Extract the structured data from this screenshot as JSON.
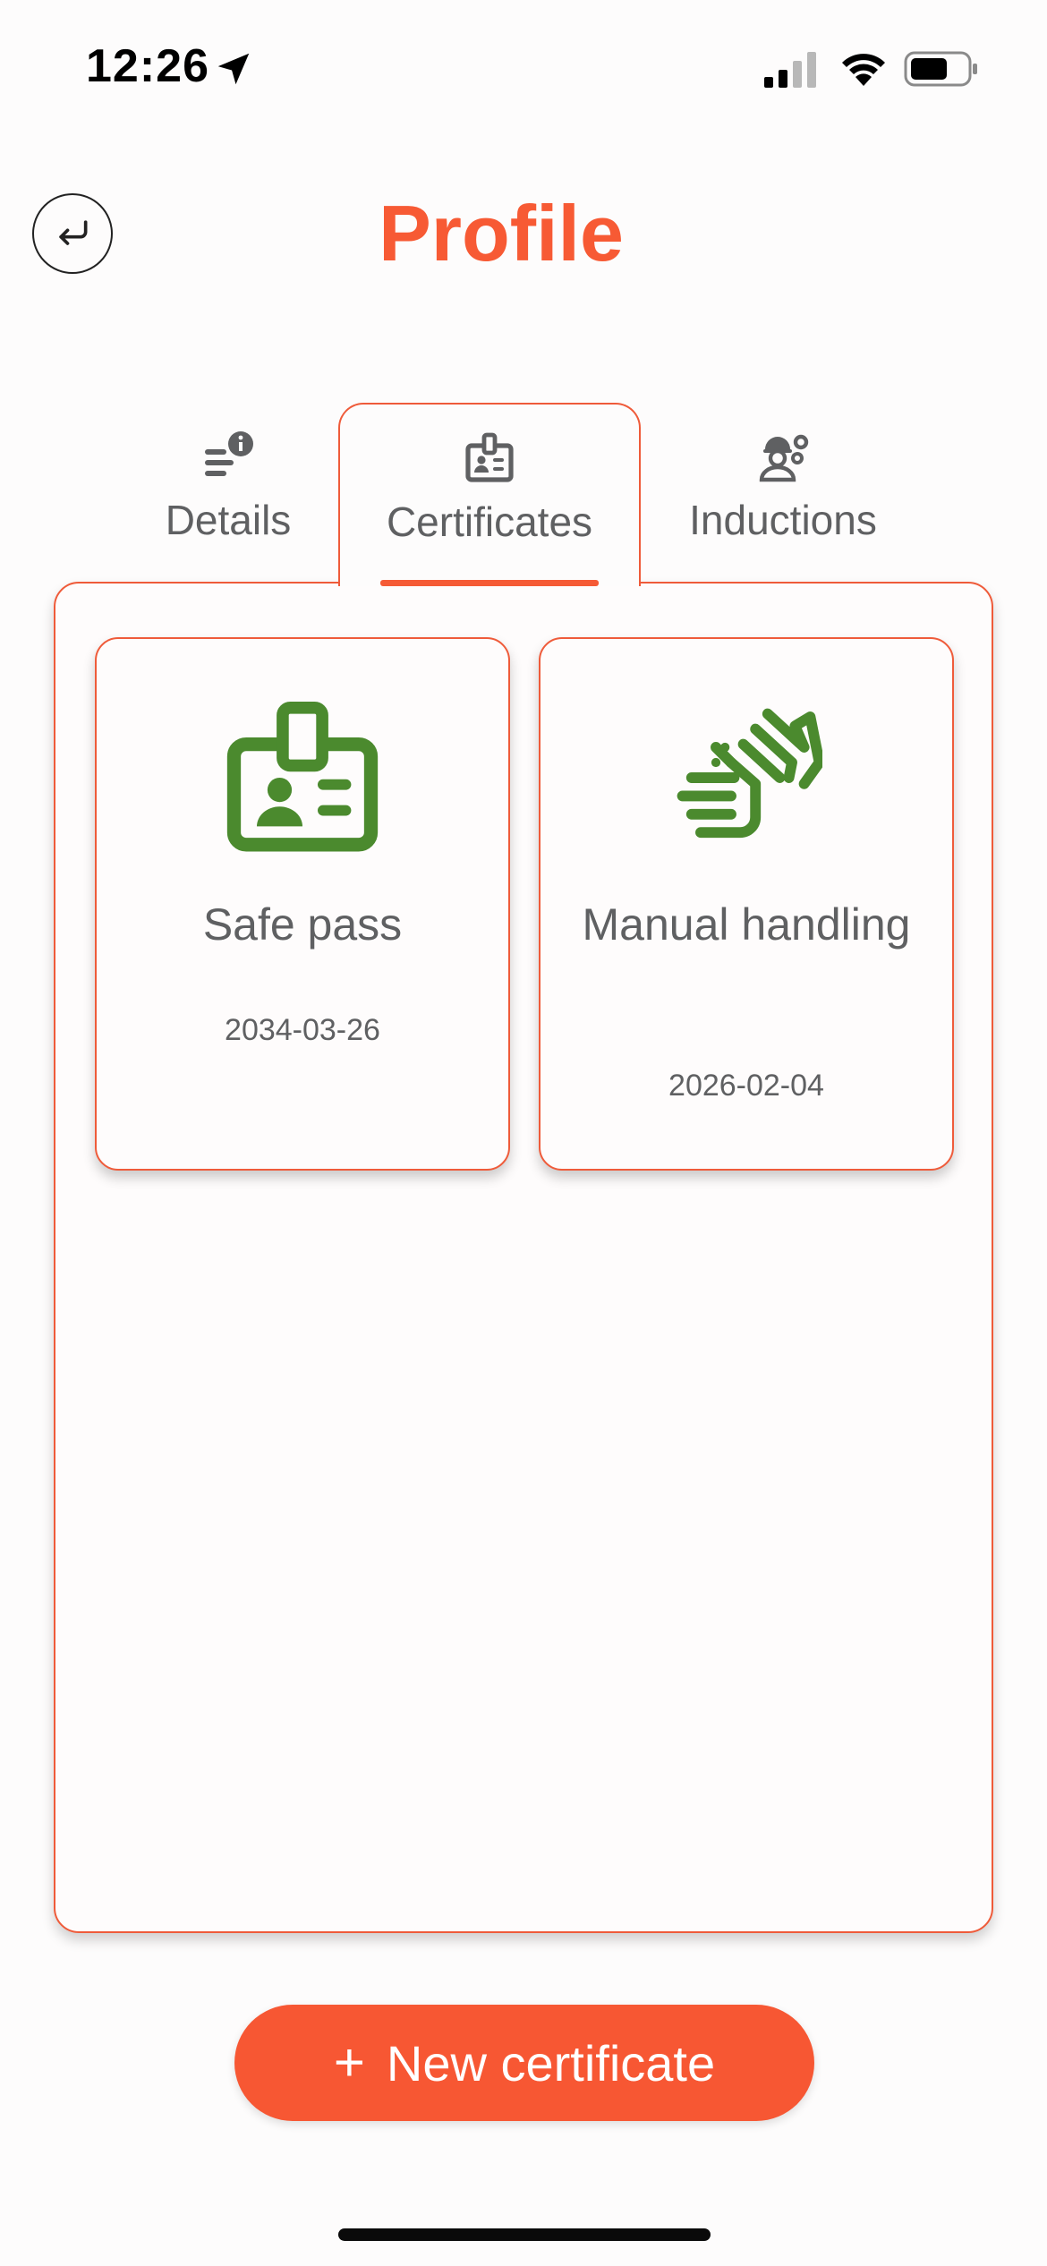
{
  "status_bar": {
    "time": "12:26"
  },
  "header": {
    "title": "Profile"
  },
  "tabs": [
    {
      "label": "Details",
      "icon": "details-info-icon",
      "active": false
    },
    {
      "label": "Certificates",
      "icon": "id-badge-icon",
      "active": true
    },
    {
      "label": "Inductions",
      "icon": "worker-gear-icon",
      "active": false
    }
  ],
  "certificates": [
    {
      "title": "Safe pass",
      "date": "2034-03-26",
      "icon": "id-badge-icon"
    },
    {
      "title": "Manual handling",
      "date": "2026-02-04",
      "icon": "hands-icon"
    }
  ],
  "actions": {
    "new_certificate_label": "New certificate",
    "plus_symbol": "+"
  },
  "colors": {
    "accent": "#f75a34",
    "icon_green": "#4b8a2e",
    "text": "#5f6062",
    "background": "#fdfcfc"
  }
}
